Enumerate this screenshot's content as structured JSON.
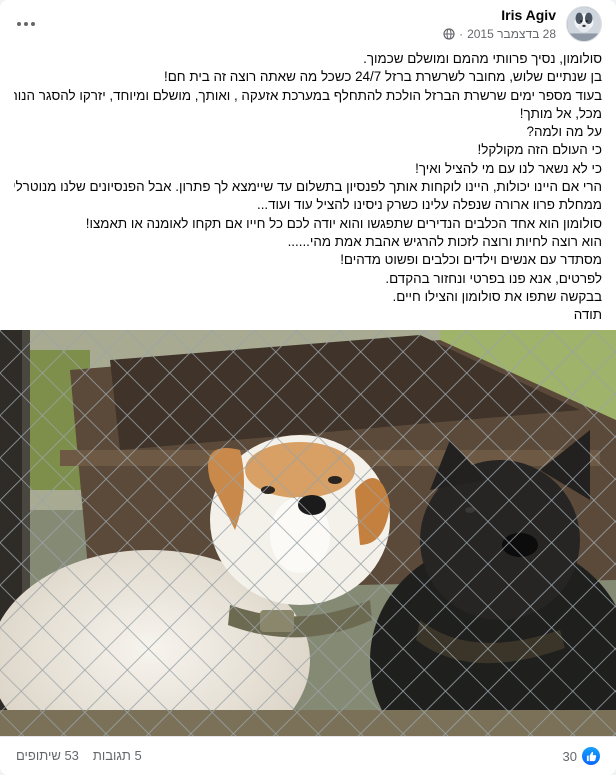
{
  "post": {
    "author": "Iris Agiv",
    "date": "28 בדצמבר 2015",
    "privacy_icon": "globe-icon",
    "more_icon": "more-options-icon",
    "lines": [
      "סולומון, נסיך פרוותי מהמם ומושלם שכמוך.",
      "בן שנתיים שלוש, מחובר לשרשרת ברזל 24/7 כשכל מה שאתה רוצה זה בית חם!",
      "בעוד מספר ימים שרשרת הברזל הולכת להתחלף במערכת אזעקה , ואותך, מושלם ומיוחד, יזרקו להסגר הנורא",
      "מכל, אל מותך!",
      "על מה ולמה?",
      "כי העולם הזה מקולקל!",
      "כי לא נשאר לנו עם מי להציל ואיך!",
      "הרי אם היינו יכולות, היינו לוקחות אותך לפנסיון בתשלום עד שיימצא לך פתרון. אבל הפנסיונים שלנו מנוטרלים",
      "ממחלת פרוו ארורה שנפלה עלינו כשרק ניסינו להציל עוד ועוד...",
      "סולומון הוא אחד הכלבים הנדירים שתפגשו והוא יודה לכם כל חייו אם תקחו לאומנה או תאמצו!",
      "הוא רוצה לחיות ורוצה לזכות להרגיש אהבת אמת מהי......",
      "מסתדר עם אנשים וילדים וכלבים ופשוט מדהים!",
      "לפרטים, אנא פנו בפרטי ונחזור בהקדם.",
      "בבקשה שתפו את סולומון והצילו חיים.",
      "תודה"
    ]
  },
  "photo": {
    "icon": "dogs-behind-fence-photo"
  },
  "footer": {
    "reaction_icon": "like-icon",
    "reaction_count": "30",
    "comments": "5 תגובות",
    "shares": "53 שיתופים"
  },
  "colors": {
    "secondary_text": "#65676b",
    "like_blue": "#0866ff",
    "divider": "#e4e6eb"
  }
}
